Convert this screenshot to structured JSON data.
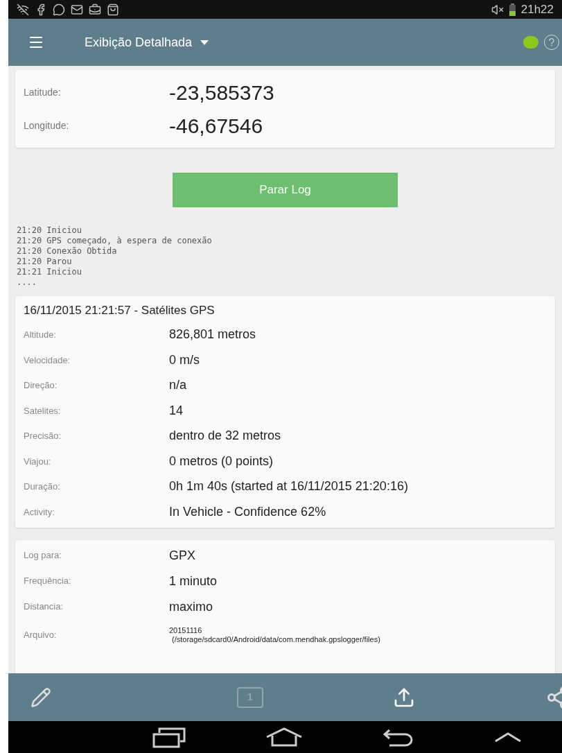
{
  "status_bar": {
    "time": "21h22"
  },
  "app_bar": {
    "title": "Exibição Detalhada",
    "status_on": true
  },
  "coordinates": [
    {
      "label": "Latitude:",
      "value": "-23,585373"
    },
    {
      "label": "Longitude:",
      "value": "-46,67546"
    }
  ],
  "stop_button": "Parar Log",
  "log_lines": [
    "21:20 Iniciou",
    "21:20 GPS começado, à espera de conexão",
    "21:20 Conexão Obtida",
    "21:20 Parou",
    "21:21 Iniciou"
  ],
  "log_more": "....",
  "gps_card": {
    "title": "16/11/2015 21:21:57 - Satélites GPS",
    "rows": [
      {
        "label": "Altitude:",
        "value": "826,801 metros"
      },
      {
        "label": "Velocidade:",
        "value": "0 m/s"
      },
      {
        "label": "Direção:",
        "value": "n/a"
      },
      {
        "label": "Satelites:",
        "value": "14"
      },
      {
        "label": "Precisão:",
        "value": "dentro de 32 metros"
      },
      {
        "label": "Viajou:",
        "value": "0 metros (0 points)"
      },
      {
        "label": "Duração:",
        "value": "0h 1m 40s (started at 16/11/2015 21:20:16)"
      },
      {
        "label": "Activity:",
        "value": "In Vehicle - Confidence 62%"
      }
    ]
  },
  "settings_card": {
    "rows": [
      {
        "label": "Log para:",
        "value": "GPX"
      },
      {
        "label": "Frequência:",
        "value": "1 minuto"
      },
      {
        "label": "Distancia:",
        "value": "maximo"
      }
    ],
    "file": {
      "label": "Arquivo:",
      "name": "20151116",
      "path": "(/storage/sdcard0/Android/data/com.mendhak.gpslogger/files)"
    }
  },
  "bottom_bar": {
    "page_number": "1"
  }
}
